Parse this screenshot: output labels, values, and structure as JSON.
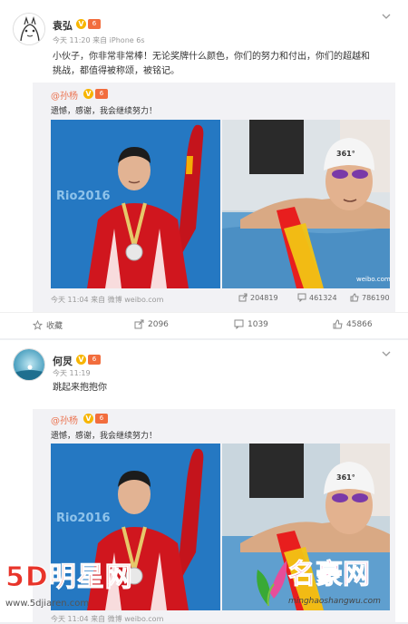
{
  "posts": [
    {
      "username": "袁弘",
      "meta": "今天 11:20 来自 iPhone 6s",
      "text_line1": "小伙子，你非常非常棒！无论奖牌什么颜色，你们的努力和付出，你们的超越和",
      "text_line2": "挑战，都值得被称颂，被铭记。",
      "repost": {
        "mention": "@孙杨",
        "text": "遗憾，感谢，我会继续努力！",
        "photo_watermark": "weibo.com/s",
        "footer": "今天 11:04 来自 微博 weibo.com",
        "shares": "204819",
        "comments": "461324",
        "likes": "786190"
      },
      "actions": {
        "fav": "收藏",
        "share": "2096",
        "comment": "1039",
        "like": "45866"
      }
    },
    {
      "username": "何炅",
      "meta": "今天 11:19",
      "text_line1": "跳起来抱抱你",
      "repost": {
        "mention": "@孙杨",
        "text": "遗憾，感谢，我会继续努力！",
        "footer": "今天 11:04 来自 微博 weibo.com"
      }
    }
  ],
  "photo_text": {
    "rio": "Rio2016",
    "cap": "361°",
    "badge_v": "V",
    "badge_level": "6"
  },
  "watermarks": {
    "left_brand": "5D明星网",
    "left_url": "www.5djiaren.com",
    "right_brand": "名豪网",
    "right_url": "minghaoshangwu.com"
  },
  "colors": {
    "accent": "#eb7350",
    "vip": "#f7b500",
    "level": "#f26d3d",
    "bg": "#eef0f3"
  }
}
